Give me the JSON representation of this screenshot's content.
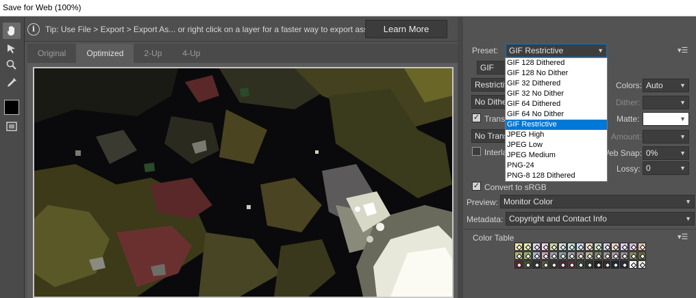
{
  "window": {
    "title": "Save for Web (100%)"
  },
  "tip": {
    "text": "Tip: Use File > Export > Export As... or right click on a layer for a faster way to export assets",
    "learn_more": "Learn More"
  },
  "view_tabs": [
    "Original",
    "Optimized",
    "2-Up",
    "4-Up"
  ],
  "active_tab": "Optimized",
  "settings": {
    "preset_label": "Preset:",
    "preset_value": "GIF Restrictive",
    "format_value": "GIF",
    "reduction_value": "Restrictive",
    "dither_algo_value": "No Dither",
    "colors_label": "Colors:",
    "colors_value": "Auto",
    "dither_label": "Dither:",
    "transparency_label": "Transparency",
    "matte_label": "Matte:",
    "transparency_dither_value": "No Transparency Dither",
    "amount_label": "Amount:",
    "interlaced_label": "Interlaced",
    "web_snap_label": "Web Snap:",
    "web_snap_value": "0%",
    "lossy_label": "Lossy:",
    "lossy_value": "0",
    "convert_srgb_label": "Convert to sRGB",
    "preview_label": "Preview:",
    "preview_value": "Monitor Color",
    "metadata_label": "Metadata:",
    "metadata_value": "Copyright and Contact Info",
    "color_table_label": "Color Table"
  },
  "preset_options": [
    "GIF 128 Dithered",
    "GIF 128 No Dither",
    "GIF 32 Dithered",
    "GIF 32 No Dither",
    "GIF 64 Dithered",
    "GIF 64 No Dither",
    "GIF Restrictive",
    "JPEG High",
    "JPEG Low",
    "JPEG Medium",
    "PNG-24",
    "PNG-8 128 Dithered"
  ],
  "selected_preset_index": 6,
  "checkboxes": {
    "transparency": true,
    "interlaced": false,
    "convert_srgb": true
  },
  "colors": {
    "accent": "#0078d7",
    "panel_bg": "#535353",
    "field_bg": "#3d3d3d"
  },
  "color_table": [
    [
      "#f3e6a4",
      "#e3ee9c",
      "#d8d4ec",
      "#f4d0ea",
      "#ccd89a",
      "#d0e4e0",
      "#bfe0d8",
      "#c8d6f4",
      "#e8d8b6",
      "#c4d8bc",
      "#d4d0e8",
      "#eed2c8",
      "#d8c8f0",
      "#d0bcd8",
      "#e4c4b4"
    ],
    [
      "#b4b07a",
      "#9ab06a",
      "#a8b0c6",
      "#c8a4b6",
      "#a89aa6",
      "#8ea0a8",
      "#a0a6a8",
      "#a49a8c",
      "#bab49e",
      "#7e8c6c",
      "#a09490",
      "#a49c98",
      "#9c8c9a",
      "#848a5e",
      "#6e6a40"
    ],
    [
      "#5a2a2c",
      "#4b5230",
      "#343434",
      "#5a5c3c",
      "#3c3a2c",
      "#4a2a3c",
      "#62303c",
      "#3c4a3c",
      "#2a3a2a",
      "#242424",
      "#3a2a2a",
      "#1c2a3a",
      "#2c2c3a",
      "#ffffff",
      "#e8e8e8"
    ]
  ]
}
